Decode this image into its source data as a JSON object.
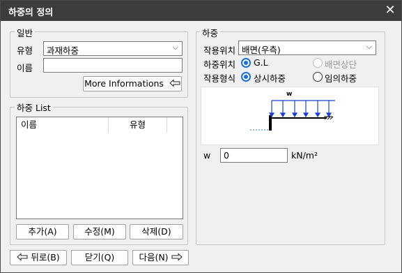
{
  "window": {
    "title": "하중의 정의",
    "close_glyph": "✕"
  },
  "general": {
    "legend": "일반",
    "type_label": "유형",
    "type_value": "과재하중",
    "name_label": "이름",
    "name_value": "",
    "more_button": "More Informations"
  },
  "load_list": {
    "legend": "하중 List",
    "columns": [
      "이름",
      "유형"
    ],
    "rows": [],
    "add_button": "추가(A)",
    "edit_button": "수정(M)",
    "delete_button": "삭제(D)"
  },
  "load": {
    "legend": "하중",
    "position_label": "작용위치",
    "position_value": "배면(우측)",
    "load_pos_label": "하중위치",
    "load_pos_options": [
      "G.L",
      "배면상단"
    ],
    "load_pos_selected": "G.L",
    "action_label": "작용형식",
    "action_options": [
      "상시하중",
      "임의하중"
    ],
    "action_selected": "상시하중",
    "diagram_label": "w",
    "w_label": "w",
    "w_value": "0",
    "w_unit": "kN/m²"
  },
  "footer": {
    "back_button": "뒤로(B)",
    "close_button": "닫기(Q)",
    "next_button": "다음(N)"
  },
  "colors": {
    "titlebar": "#3c3c3c",
    "accent": "#1a6fd6",
    "load_arrows": "#1a3fd6"
  }
}
